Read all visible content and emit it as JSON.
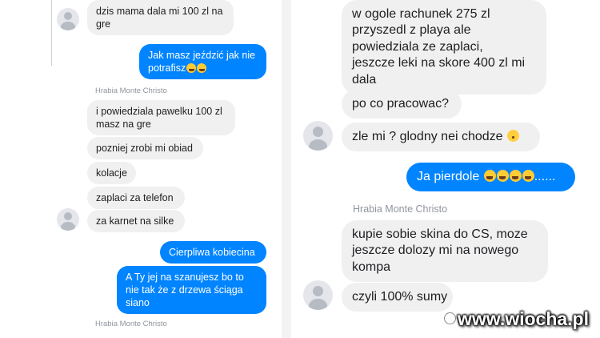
{
  "left": {
    "messages": [
      {
        "dir": "in",
        "text": "dzis mama dala mi 100 zl na\ngre"
      },
      {
        "dir": "out",
        "text": "Jak masz jeździć jak nie\npotrafisz",
        "emoji_count": 2
      },
      {
        "dir": "in",
        "text": "i powiedziala pawelku 100 zl\nmasz na gre"
      },
      {
        "dir": "in",
        "text": "pozniej zrobi mi obiad"
      },
      {
        "dir": "in",
        "text": "kolacje"
      },
      {
        "dir": "in",
        "text": "zaplaci za telefon"
      },
      {
        "dir": "in",
        "text": "za karnet na silke"
      },
      {
        "dir": "out",
        "text": "Cierpliwa kobiecina"
      },
      {
        "dir": "out",
        "text": "A Ty jej na szanujesz bo to\nnie tak że z drzewa ściąga\nsiano"
      }
    ],
    "sender_names": [
      "Hrabia Monte Christo",
      "Hrabia Monte Christo"
    ]
  },
  "right": {
    "messages": [
      {
        "dir": "in",
        "text": "w ogole rachunek 275 zl\nprzyszedl z playa ale\npowiedziala ze zaplaci,\njeszcze leki na skore 400 zl mi\ndala"
      },
      {
        "dir": "in",
        "text": "po co pracowac?"
      },
      {
        "dir": "in",
        "text": "zle mi ? glodny nei chodze",
        "emoji": "neutral-face"
      },
      {
        "dir": "out",
        "text_before": "Ja pierdole",
        "emoji_count": 4,
        "text_after": "......"
      },
      {
        "dir": "in",
        "text": "kupie sobie skina do CS, moze\njeszcze dolozy mi na nowego\nkompa"
      },
      {
        "dir": "in",
        "text": "czyli 100% sumy"
      }
    ],
    "sender_name": "Hrabia Monte Christo"
  },
  "watermark": "www.wiocha.pl",
  "colors": {
    "incoming_bubble": "#f1f0f0",
    "outgoing_bubble": "#0084ff",
    "incoming_text": "#1c1e21",
    "outgoing_text": "#ffffff",
    "meta_text": "#90949c"
  }
}
